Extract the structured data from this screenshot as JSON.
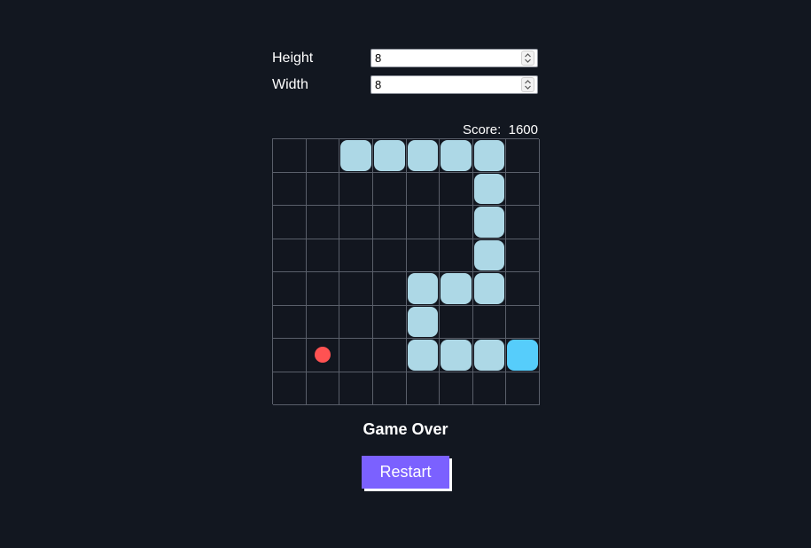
{
  "settings": {
    "height_label": "Height",
    "height_value": "8",
    "width_label": "Width",
    "width_value": "8"
  },
  "score": {
    "text": "Score:  1600"
  },
  "board": {
    "rows": 8,
    "cols": 8,
    "snake_body": [
      [
        0,
        2
      ],
      [
        0,
        3
      ],
      [
        0,
        4
      ],
      [
        0,
        5
      ],
      [
        0,
        6
      ],
      [
        1,
        6
      ],
      [
        2,
        6
      ],
      [
        3,
        6
      ],
      [
        4,
        6
      ],
      [
        4,
        5
      ],
      [
        4,
        4
      ],
      [
        5,
        4
      ],
      [
        6,
        4
      ],
      [
        6,
        5
      ],
      [
        6,
        6
      ]
    ],
    "snake_head": [
      6,
      7
    ],
    "food": [
      6,
      1
    ],
    "colors": {
      "background": "#121720",
      "grid_line": "#5a5f6a",
      "snake_body": "#add8e6",
      "snake_head": "#56cdfb",
      "food": "#ff5252"
    }
  },
  "status": "Game Over",
  "restart_label": "Restart",
  "accent_color": "#7b61ff"
}
